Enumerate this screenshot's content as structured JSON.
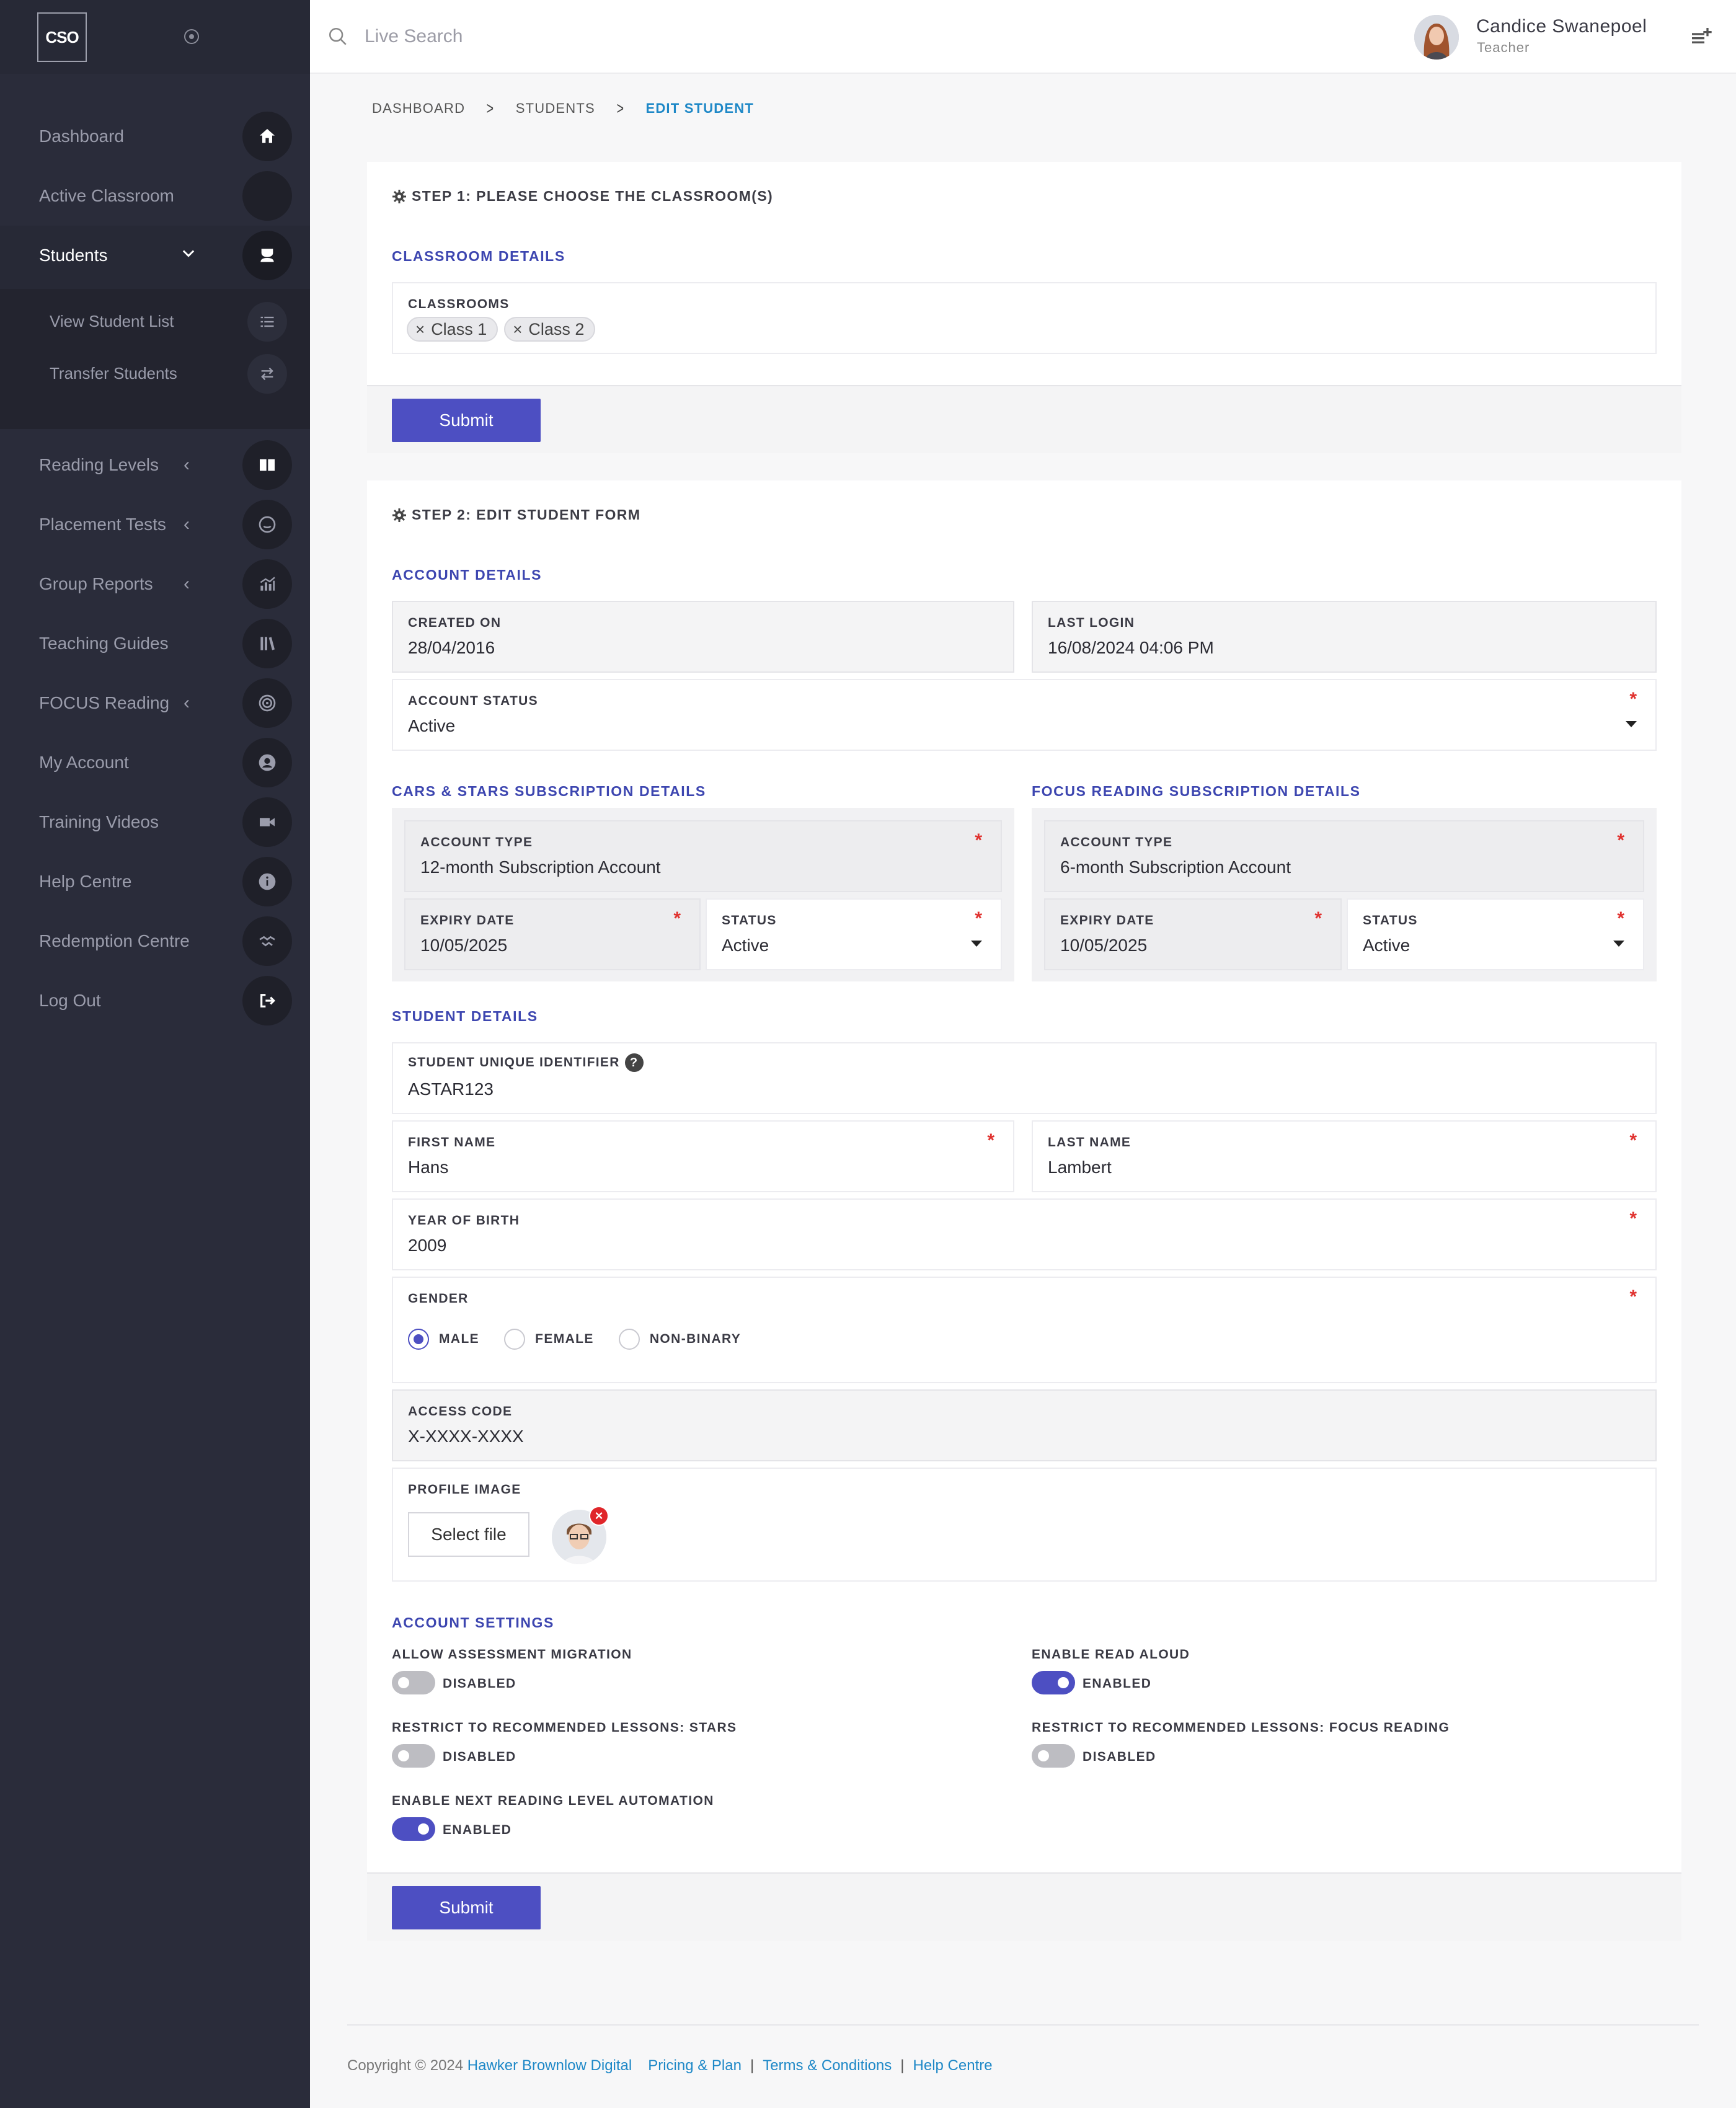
{
  "sidebar": {
    "logo": "CSO",
    "items": [
      {
        "label": "Dashboard",
        "icon": "home-icon"
      },
      {
        "label": "Active Classroom",
        "icon": "classroom-icon"
      },
      {
        "label": "Students",
        "icon": "student-icon"
      },
      {
        "label": "Reading Levels",
        "icon": "book-icon"
      },
      {
        "label": "Placement Tests",
        "icon": "smiley-icon"
      },
      {
        "label": "Group Reports",
        "icon": "chart-icon"
      },
      {
        "label": "Teaching Guides",
        "icon": "guides-icon"
      },
      {
        "label": "FOCUS Reading",
        "icon": "target-icon"
      },
      {
        "label": "My Account",
        "icon": "user-icon"
      },
      {
        "label": "Training Videos",
        "icon": "video-icon"
      },
      {
        "label": "Help Centre",
        "icon": "info-icon"
      },
      {
        "label": "Redemption Centre",
        "icon": "handshake-icon"
      },
      {
        "label": "Log Out",
        "icon": "logout-icon"
      }
    ],
    "sub_items": [
      {
        "label": "View Student List",
        "icon": "list-icon"
      },
      {
        "label": "Transfer Students",
        "icon": "transfer-icon"
      }
    ]
  },
  "topbar": {
    "search_placeholder": "Live Search",
    "user_name": "Candice Swanepoel",
    "user_role": "Teacher"
  },
  "breadcrumb": [
    "Dashboard",
    "Students",
    "Edit Student"
  ],
  "step1": {
    "title": "Step 1: Please choose the classroom(s)",
    "section": "Classroom Details",
    "classrooms_label": "Classrooms",
    "classrooms": [
      "Class 1",
      "Class 2"
    ],
    "submit": "Submit"
  },
  "step2": {
    "title": "Step 2: Edit Student Form",
    "account_details": "Account Details",
    "created_on_label": "Created On",
    "created_on": "28/04/2016",
    "last_login_label": "Last Login",
    "last_login": "16/08/2024 04:06 PM",
    "account_status_label": "Account Status",
    "account_status": "Active",
    "cars_title": "Cars & Stars Subscription Details",
    "focus_title": "FOCUS Reading Subscription Details",
    "cars": {
      "account_type_label": "Account Type",
      "account_type": "12-month Subscription Account",
      "expiry_label": "Expiry Date",
      "expiry": "10/05/2025",
      "status_label": "Status",
      "status": "Active"
    },
    "focus": {
      "account_type_label": "Account Type",
      "account_type": "6-month Subscription Account",
      "expiry_label": "Expiry Date",
      "expiry": "10/05/2025",
      "status_label": "Status",
      "status": "Active"
    },
    "student_details": "Student Details",
    "uid_label": "Student Unique Identifier",
    "uid_help": "?",
    "uid": "ASTAR123",
    "first_name_label": "First Name",
    "first_name": "Hans",
    "last_name_label": "Last Name",
    "last_name": "Lambert",
    "yob_label": "Year of Birth",
    "yob": "2009",
    "gender_label": "Gender",
    "genders": [
      "Male",
      "Female",
      "Non-Binary"
    ],
    "gender_selected": "Male",
    "access_code_label": "Access Code",
    "access_code": "X-XXXX-XXXX",
    "profile_image_label": "Profile Image",
    "select_file": "Select file",
    "remove_image": "×",
    "account_settings": "Account Settings",
    "settings": {
      "allow_migration_label": "Allow Assessment Migration",
      "allow_migration_state": "Disabled",
      "read_aloud_label": "Enable Read Aloud",
      "read_aloud_state": "Enabled",
      "restrict_stars_label": "Restrict to recommended lessons: Stars",
      "restrict_stars_state": "Disabled",
      "restrict_focus_label": "Restrict to recommended lessons: FOCUS Reading",
      "restrict_focus_state": "Disabled",
      "next_level_label": "Enable Next Reading Level Automation",
      "next_level_state": "Enabled"
    },
    "submit": "Submit"
  },
  "footer": {
    "copyright": "Copyright © 2024",
    "company": "Hawker Brownlow Digital",
    "links": [
      "Pricing & Plan",
      "Terms & Conditions",
      "Help Centre"
    ],
    "sep": "|"
  },
  "colors": {
    "accent": "#4d4fc2",
    "link": "#1e88c7",
    "sidebar": "#2a2c3a",
    "required": "#e0312e"
  }
}
